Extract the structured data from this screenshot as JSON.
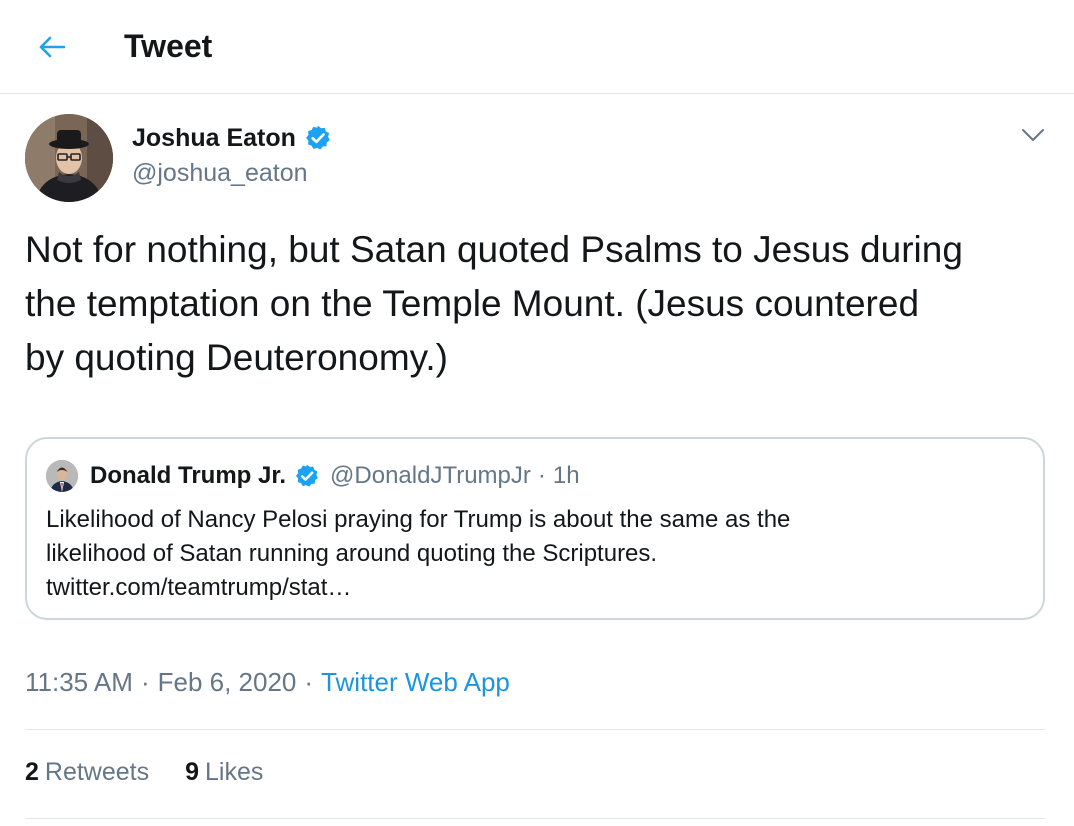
{
  "header": {
    "title": "Tweet",
    "back_icon": "arrow-left-icon"
  },
  "tweet": {
    "author": {
      "name": "Joshua Eaton",
      "handle": "@joshua_eaton",
      "verified": true
    },
    "text": "Not for nothing, but Satan quoted Psalms to Jesus during\nthe temptation on the Temple Mount. (Jesus countered\nby quoting Deuteronomy.)",
    "time": "11:35 AM",
    "date": "Feb 6, 2020",
    "source": "Twitter Web App",
    "separator": "·",
    "stats": {
      "retweets_count": "2",
      "retweets_label": "Retweets",
      "likes_count": "9",
      "likes_label": "Likes"
    }
  },
  "quoted_tweet": {
    "author": {
      "name": "Donald Trump Jr.",
      "handle": "@DonaldJTrumpJr",
      "verified": true
    },
    "separator": "·",
    "time": "1h",
    "text": "Likelihood of Nancy Pelosi praying for Trump is about the same as the\nlikelihood of Satan running around quoting the Scriptures.\ntwitter.com/teamtrump/stat…"
  },
  "colors": {
    "accent": "#1da1f2",
    "link": "#1b95e0",
    "secondary_text": "#657786",
    "border": "#e1e8ed"
  }
}
